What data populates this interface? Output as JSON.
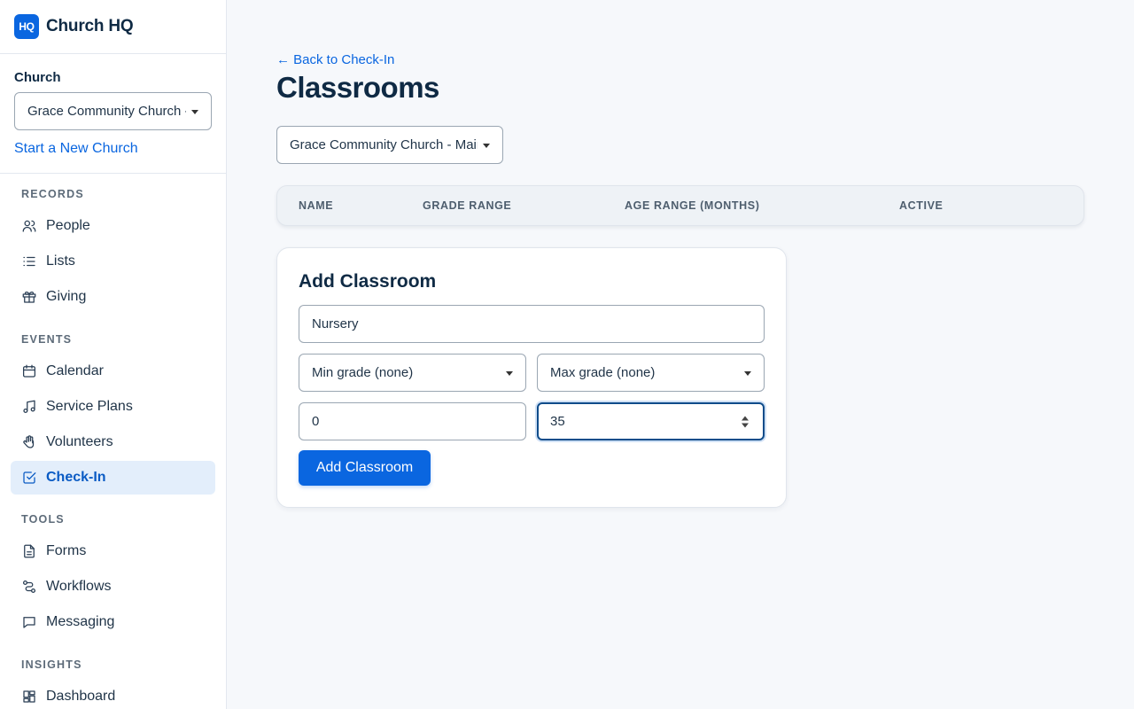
{
  "brand": {
    "logo_text": "HQ",
    "name": "Church HQ"
  },
  "sidebar": {
    "church_label": "Church",
    "church_select_value": "Grace Community Church - Main Campus",
    "new_church_link": "Start a New Church",
    "sections": [
      {
        "heading": "RECORDS",
        "items": [
          {
            "label": "People",
            "icon": "people-icon"
          },
          {
            "label": "Lists",
            "icon": "list-icon"
          },
          {
            "label": "Giving",
            "icon": "gift-icon"
          }
        ]
      },
      {
        "heading": "EVENTS",
        "items": [
          {
            "label": "Calendar",
            "icon": "calendar-icon"
          },
          {
            "label": "Service Plans",
            "icon": "music-icon"
          },
          {
            "label": "Volunteers",
            "icon": "hand-icon"
          },
          {
            "label": "Check-In",
            "icon": "check-square-icon",
            "active": true
          }
        ]
      },
      {
        "heading": "TOOLS",
        "items": [
          {
            "label": "Forms",
            "icon": "file-icon"
          },
          {
            "label": "Workflows",
            "icon": "workflow-icon"
          },
          {
            "label": "Messaging",
            "icon": "message-icon"
          }
        ]
      },
      {
        "heading": "INSIGHTS",
        "items": [
          {
            "label": "Dashboard",
            "icon": "dashboard-icon"
          }
        ]
      }
    ]
  },
  "main": {
    "back_link": "← Back to Check-In",
    "title": "Classrooms",
    "campus_select_value": "Grace Community Church - Main Campus",
    "table_headers": [
      "NAME",
      "GRADE RANGE",
      "AGE RANGE (MONTHS)",
      "ACTIVE"
    ],
    "add_form": {
      "title": "Add Classroom",
      "name_value": "Nursery",
      "min_grade_value": "Min grade (none)",
      "max_grade_value": "Max grade (none)",
      "min_age_value": "0",
      "max_age_value": "35",
      "submit_label": "Add Classroom"
    }
  },
  "colors": {
    "accent": "#0a66e0",
    "active_bg": "#e3eefb",
    "text": "#0f2a44"
  }
}
